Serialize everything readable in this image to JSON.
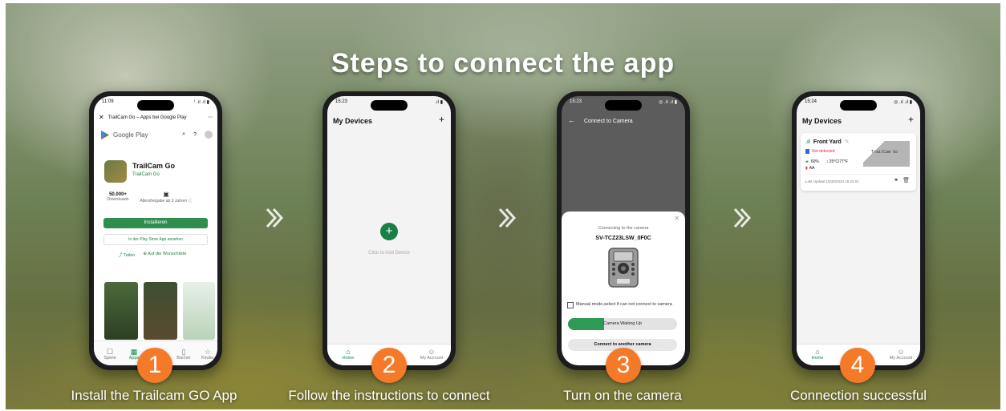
{
  "headline": "Steps to connect the app",
  "colors": {
    "accent_orange": "#f47a2a",
    "app_green": "#1a7f44",
    "play_green": "#2f8e4e"
  },
  "steps": [
    {
      "number": "1",
      "caption": "Install the Trailcam GO App",
      "time": "11:09",
      "status_icons": "ᵗ .ıl .ıl ▮",
      "page_title": "TrailCam Go – Apps bei Google Play",
      "store_name": "Google Play",
      "app_name": "TrailCam Go",
      "developer": "TrailCam Go",
      "downloads_count": "50.000+",
      "downloads_label": "Downloads",
      "age_label": "Altersfreigabe ab 3 Jahren ⓘ",
      "install_label": "Installieren",
      "open_store_label": "In der Play Store App ansehen",
      "share_label": "Teilen",
      "wishlist_label": "Auf die Wunschliste",
      "nav": [
        {
          "icon": "☐",
          "label": "Spiele"
        },
        {
          "icon": "▦",
          "label": "Apps"
        },
        {
          "icon": "▯",
          "label": ""
        },
        {
          "icon": "▯",
          "label": "Bücher"
        },
        {
          "icon": "☆",
          "label": "Kinder"
        }
      ]
    },
    {
      "number": "2",
      "caption": "Follow the instructions to connect",
      "time": "15:23",
      "status_icons": ".ıl ▮",
      "title": "My Devices",
      "add_symbol": "+",
      "add_hint": "Click to Add Device",
      "nav_home": "Home",
      "nav_account": "My Account"
    },
    {
      "number": "3",
      "caption": "Turn on the camera",
      "time": "15:23",
      "status_icons": "◎ .ıl .ıl ▮",
      "title": "Connect to Camera",
      "dialog_heading": "Connecting to the camera",
      "camera_id": "SV-TCZ23LSW_0F0C",
      "manual_mode_label": "Manual mode,select if can not connect to camera",
      "waking_label": "Camera Waking Up",
      "waking_progress": 0.33,
      "connect_another_label": "Connect to another camera"
    },
    {
      "number": "4",
      "caption": "Connection successful",
      "time": "15:24",
      "status_icons": "◎ .ıl .ıl ▮",
      "title": "My Devices",
      "device_name": "Front Yard",
      "device_status": "Not detected",
      "battery": "60%",
      "power": "AA",
      "temperature": "↕ 25°C/77°F",
      "thumbnail_text": "TrailCam Go",
      "last_update": "Last Update:10/30/2024 15:24:01",
      "nav_home": "Home",
      "nav_account": "My Account"
    }
  ]
}
